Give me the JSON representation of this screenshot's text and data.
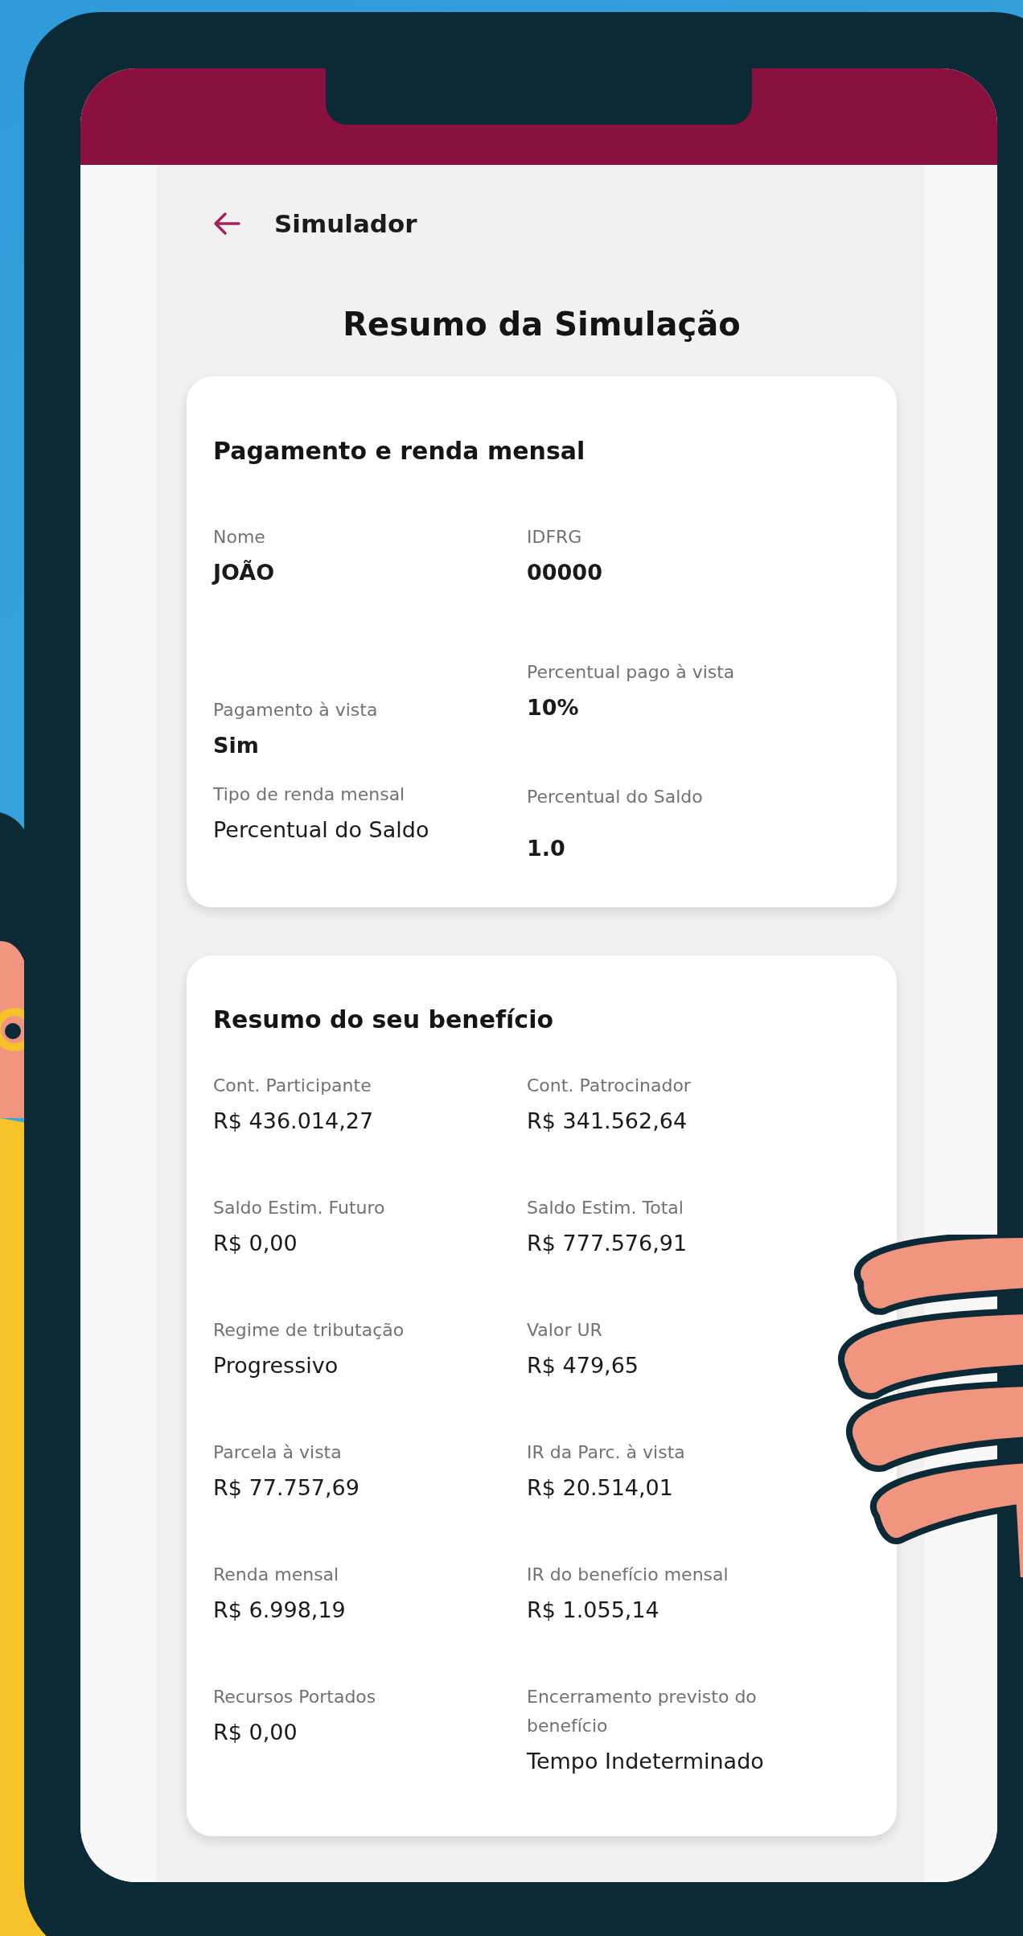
{
  "header": {
    "title": "Simulador"
  },
  "page_title": "Resumo da Simulação",
  "cards": [
    {
      "title": "Pagamento e renda mensal",
      "columns": [
        [
          {
            "label": "Nome",
            "value": "JOÃO"
          },
          {
            "label": "Pagamento à vista",
            "value": "Sim"
          },
          {
            "label": "Tipo de renda mensal",
            "value": "Percentual do Saldo"
          }
        ],
        [
          {
            "label": "IDFRG",
            "value": "00000"
          },
          {
            "label": "Percentual pago à vista",
            "value": "10%"
          },
          {
            "label": "Percentual do Saldo",
            "value": "1.0"
          }
        ]
      ]
    },
    {
      "title": "Resumo do seu benefício",
      "columns": [
        [
          {
            "label": "Cont. Participante",
            "value": "R$ 436.014,27"
          },
          {
            "label": "Saldo Estim. Futuro",
            "value": "R$ 0,00"
          },
          {
            "label": "Regime de tributação",
            "value": "Progressivo"
          },
          {
            "label": "Parcela à vista",
            "value": "R$ 77.757,69"
          },
          {
            "label": "Renda mensal",
            "value": "R$ 6.998,19"
          },
          {
            "label": "Recursos Portados",
            "value": "R$ 0,00"
          }
        ],
        [
          {
            "label": "Cont. Patrocinador",
            "value": "R$ 341.562,64"
          },
          {
            "label": "Saldo Estim. Total",
            "value": "R$ 777.576,91"
          },
          {
            "label": "Valor UR",
            "value": "R$ 479,65"
          },
          {
            "label": "IR da Parc. à vista",
            "value": "R$ 20.514,01"
          },
          {
            "label": "IR do benefício mensal",
            "value": "R$ 1.055,14"
          },
          {
            "label": "Encerramento previsto do benefício",
            "value": "Tempo Indeterminado"
          }
        ]
      ]
    }
  ]
}
